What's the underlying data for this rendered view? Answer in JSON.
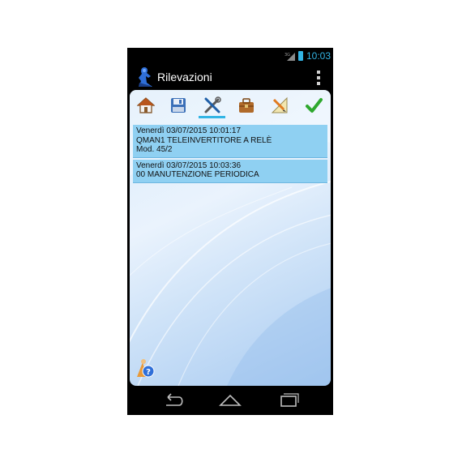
{
  "status_bar": {
    "time": "10:03",
    "accent_color": "#33b5e5",
    "signal_icon": "signal-3g-icon",
    "battery_icon": "battery-icon"
  },
  "action_bar": {
    "title": "Rilevazioni",
    "logo_icon": "app-logo-icon",
    "menu_icon": "overflow-menu-icon"
  },
  "toolbar": {
    "selected_index": 2,
    "tools": [
      {
        "icon": "home-icon"
      },
      {
        "icon": "save-icon"
      },
      {
        "icon": "tools-icon"
      },
      {
        "icon": "briefcase-icon"
      },
      {
        "icon": "pencil-ruler-icon"
      },
      {
        "icon": "checkmark-icon"
      }
    ]
  },
  "records": [
    {
      "date": "Venerdì 03/07/2015 10:01:17",
      "description": "QMAN1 TELEINVERTITORE A RELÈ",
      "extra": "Mod. 45/2"
    },
    {
      "date": "Venerdì 03/07/2015 10:03:36",
      "description": "00 MANUTENZIONE PERIODICA",
      "extra": ""
    }
  ],
  "help_button": {
    "icon": "help-person-icon"
  },
  "nav_bar": {
    "back_icon": "back-icon",
    "home_icon": "nav-home-icon",
    "recents_icon": "recents-icon"
  },
  "colors": {
    "list_item_bg": "#8fd0f2",
    "background_light": "#eaf3fd",
    "background_dark": "#a9cbf1"
  }
}
